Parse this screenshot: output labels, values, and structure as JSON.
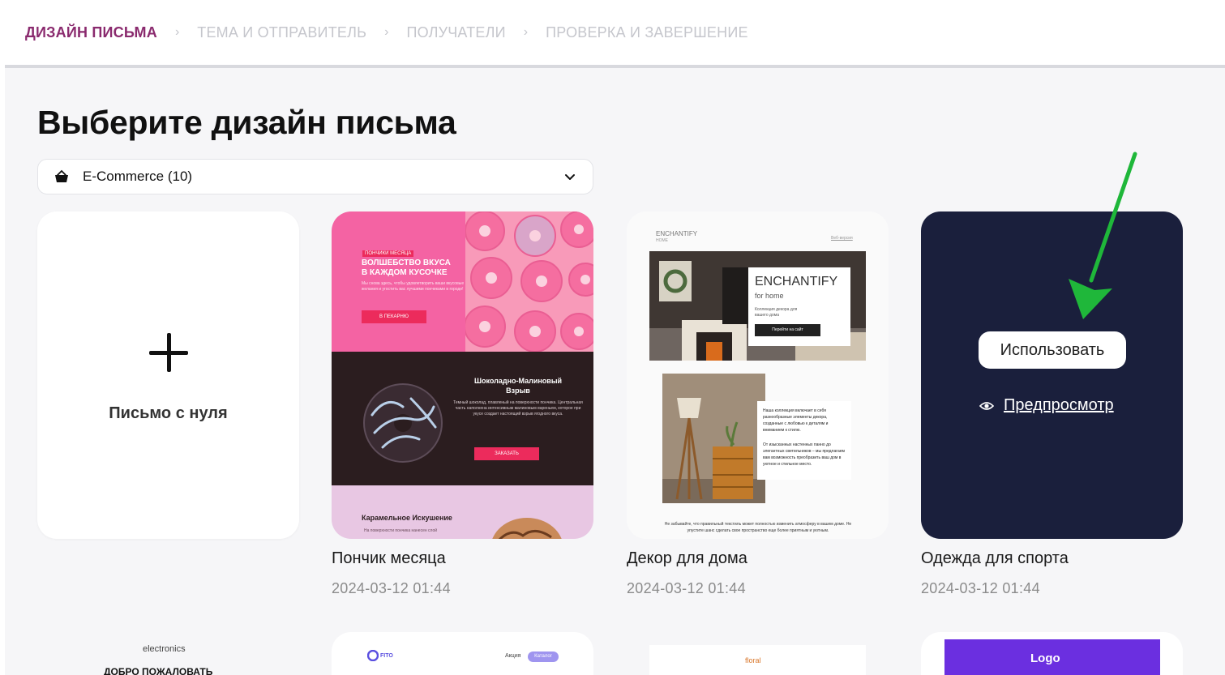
{
  "stepper": {
    "steps": [
      "ДИЗАЙН ПИСЬМА",
      "ТЕМА И ОТПРАВИТЕЛЬ",
      "ПОЛУЧАТЕЛИ",
      "ПРОВЕРКА И ЗАВЕРШЕНИЕ"
    ],
    "active_index": 0
  },
  "page": {
    "title": "Выберите дизайн письма"
  },
  "category": {
    "icon": "basket-icon",
    "selected": "E-Commerce (10)"
  },
  "blank_card": {
    "label": "Письмо с нуля"
  },
  "templates": [
    {
      "name": "Пончик месяца",
      "date": "2024-03-12 01:44",
      "preview": {
        "badge": "ПОНЧИКИ МЕСЯЦА",
        "headline_1": "ВОЛШЕБСТВО ВКУСА",
        "headline_2": "В КАЖДОМ КУСОЧКЕ",
        "intro": "Мы снова здесь, чтобы удовлетворить ваши вкусовые желания и угостить вас лучшими пончиками в городе!",
        "cta_1": "В ПЕКАРНЮ",
        "product_1_1": "Шоколадно-Малиновый",
        "product_1_2": "Взрыв",
        "product_1_text": "Темный шоколад, плавленый на поверхности пончика. Центральная часть наполнена интенсивным малиновым вареньем, которое при укусе создает настоящий взрыв ягодного вкуса.",
        "cta_2": "ЗАКАЗАТЬ",
        "product_2": "Карамельное Искушение",
        "product_2_text": "На поверхности пончика нанесен слой"
      }
    },
    {
      "name": "Декор для дома",
      "date": "2024-03-12 01:44",
      "preview": {
        "brand": "ENCHANTIFY",
        "brand_sub": "HOME",
        "top_link": "Веб-версия",
        "hero_title": "ENCHANTIFY",
        "hero_sub": "for home",
        "hero_text": "Коллекция декора для вашего дома",
        "hero_btn": "Перейти на сайт",
        "body_1": "Наша коллекция включает в себя разнообразные элементы декора, созданные с любовью к деталям и вниманием к стилю.",
        "body_2": "От изысканных настенных панно до элегантных светильников – мы предлагаем вам возможность преобразить ваш дом в уютное и стильное место.",
        "footer": "Не забывайте, что правильный текстиль может полностью изменить атмосферу в вашем доме. Не упустите шанс сделать свое пространство еще более приятным и уютным."
      }
    },
    {
      "name": "Одежда для спорта",
      "date": "2024-03-12 01:44",
      "use_label": "Использовать",
      "preview_label": "Предпросмотр"
    }
  ],
  "bottom_row": {
    "card_1_brand": "electronics",
    "card_1_text": "ДОБРО ПОЖАЛОВАТЬ",
    "card_2_brand": "FITO",
    "card_2_menu": "Акция",
    "card_2_badge": "Каталог",
    "card_3_brand": "floral",
    "card_4_brand": "Logo"
  },
  "colors": {
    "accent": "#8a2a6e",
    "sport_bg": "#1a1f3c",
    "arrow": "#1fb73a"
  }
}
